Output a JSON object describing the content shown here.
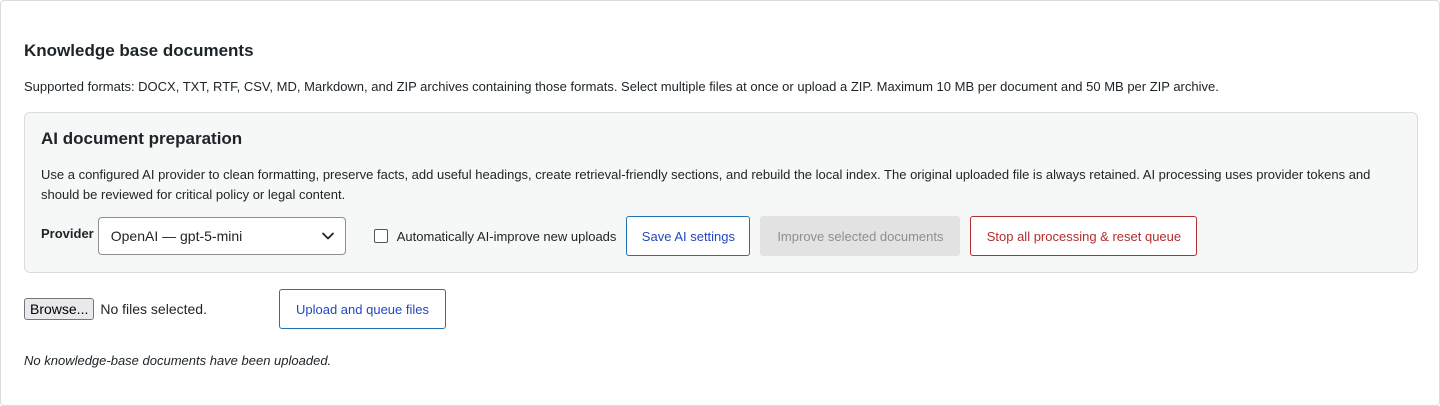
{
  "section": {
    "title": "Knowledge base documents",
    "formats_note": "Supported formats: DOCX, TXT, RTF, CSV, MD, Markdown, and ZIP archives containing those formats. Select multiple files at once or upload a ZIP. Maximum 10 MB per document and 50 MB per ZIP archive."
  },
  "ai_panel": {
    "title": "AI document preparation",
    "description": "Use a configured AI provider to clean formatting, preserve facts, add useful headings, create retrieval-friendly sections, and rebuild the local index. The original uploaded file is always retained. AI processing uses provider tokens and should be reviewed for critical policy or legal content.",
    "provider_label": "Provider",
    "provider_selected": "OpenAI — gpt-5-mini",
    "auto_improve_label": "Automatically AI-improve new uploads",
    "auto_improve_checked": false,
    "save_label": "Save AI settings",
    "improve_label": "Improve selected documents",
    "stop_label": "Stop all processing & reset queue"
  },
  "upload": {
    "browse_label": "Browse...",
    "no_files_text": "No files selected.",
    "upload_label": "Upload and queue files"
  },
  "empty_note": "No knowledge-base documents have been uploaded.",
  "icons": {
    "select_chevron": "chevron-down-icon"
  },
  "colors": {
    "accent_blue": "#2248c0",
    "danger_red": "#b32d2e",
    "panel_bg": "#f6f7f7",
    "disabled_bg": "#e2e2e2"
  }
}
